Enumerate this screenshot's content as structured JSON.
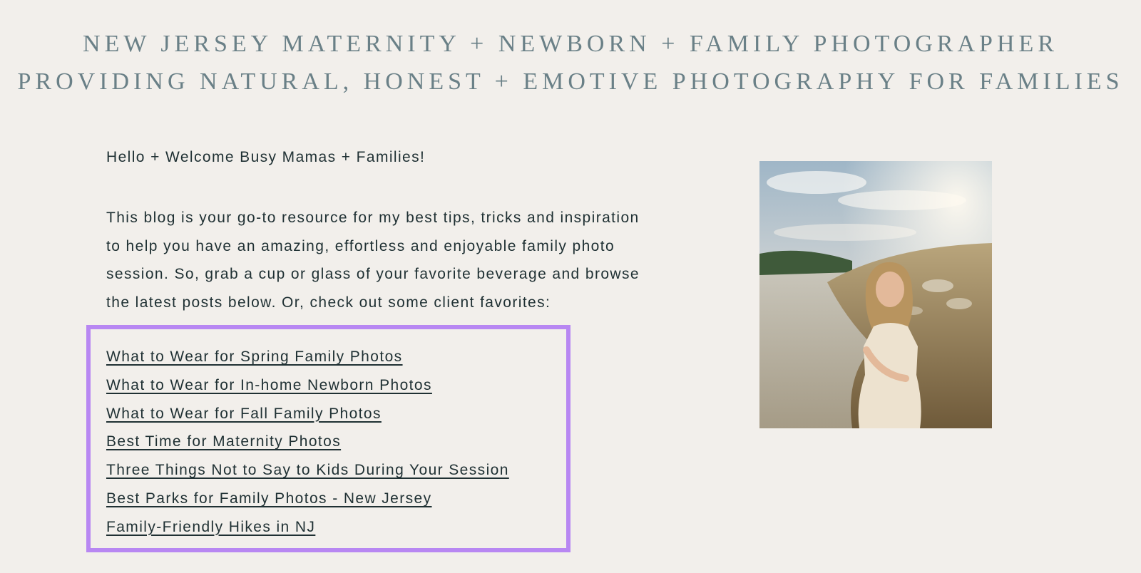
{
  "header": {
    "tagline_line1": "NEW JERSEY MATERNITY + NEWBORN + FAMILY PHOTOGRAPHER",
    "tagline_line2": "PROVIDING NATURAL, HONEST + EMOTIVE PHOTOGRAPHY FOR FAMILIES"
  },
  "main": {
    "greeting": "Hello + Welcome Busy Mamas + Families!",
    "intro_lines": [
      "This blog is your go-to resource for my best tips, tricks and inspiration",
      "to help you have an amazing, effortless and enjoyable family photo",
      "session. So, grab a cup or glass of your favorite beverage and browse",
      "the latest posts below. Or, check out some client favorites:"
    ],
    "favorite_links": [
      "What to Wear for Spring Family Photos",
      "What to Wear for In-home Newborn Photos",
      "What to Wear for Fall Family Photos",
      "Best Time for Maternity Photos",
      "Three Things Not to Say to Kids During Your Session",
      "Best Parks for Family Photos - New Jersey",
      "Family-Friendly Hikes in NJ"
    ]
  },
  "colors": {
    "background": "#f2efeb",
    "tagline": "#6a8087",
    "body_text": "#1f3033",
    "highlight_border": "#b887f2"
  }
}
